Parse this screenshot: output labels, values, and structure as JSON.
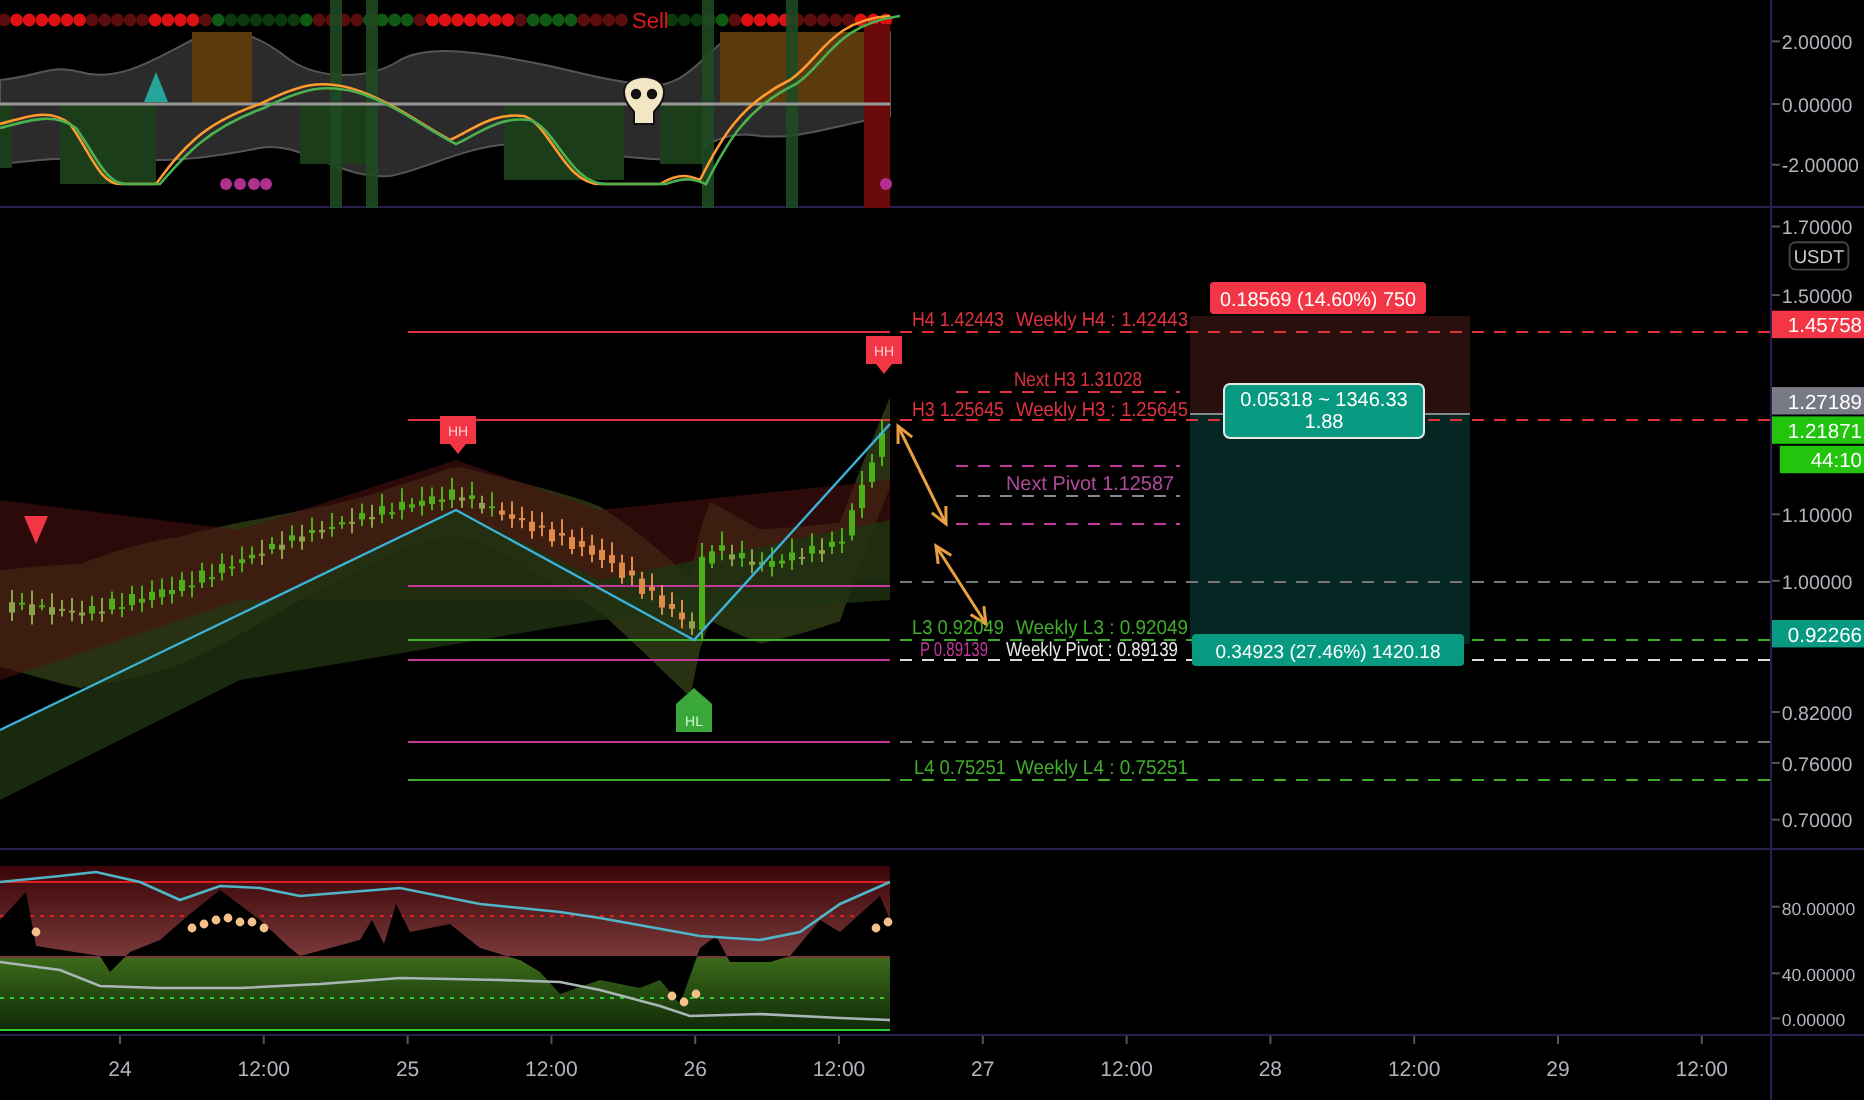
{
  "top_panel": {
    "signal_label": "Sell",
    "axis_labels": [
      "2.00000",
      "0.00000",
      "-2.00000"
    ]
  },
  "main_panel": {
    "currency": "USDT",
    "axis_labels": [
      "1.70000",
      "1.50000",
      "1.10000",
      "1.00000",
      "0.82000",
      "0.76000",
      "0.70000"
    ],
    "price_tags": [
      {
        "text": "1.45758",
        "color": "#f23645"
      },
      {
        "text": "1.27189",
        "color": "#787b86"
      },
      {
        "text": "1.21871",
        "color": "#22c40e"
      },
      {
        "text": "44:10",
        "color": "#22c40e"
      },
      {
        "text": "0.92266",
        "color": "#089981"
      }
    ],
    "pivots": [
      {
        "label": "H4 1.42443",
        "weekly_label": "Weekly H4 : 1.42443",
        "color": "#e0313f"
      },
      {
        "label": "H3 1.25645",
        "weekly_label": "Weekly H3 : 1.25645",
        "color": "#e0313f"
      },
      {
        "label": "L3 0.92049",
        "weekly_label": "Weekly L3 : 0.92049",
        "color": "#3fae2a"
      },
      {
        "label": "P 0.89139",
        "weekly_label": "Weekly Pivot : 0.89139",
        "color": "#c2399b"
      },
      {
        "label": "L4 0.75251",
        "weekly_label": "Weekly L4 : 0.75251",
        "color": "#3fae2a"
      }
    ],
    "next_levels": [
      "Next H3 1.31028",
      "Next Pivot 1.12587"
    ],
    "markers": [
      {
        "text": "HH",
        "kind": "high"
      },
      {
        "text": "HH",
        "kind": "high"
      },
      {
        "text": "HL",
        "kind": "low"
      }
    ],
    "position": {
      "target_label": "0.18569 (14.60%) 750",
      "info_lines": [
        "0.05318 ~ 1346.33",
        "1.88"
      ],
      "stop_label": "0.34923 (27.46%) 1420.18"
    }
  },
  "bottom_panel": {
    "axis_labels": [
      "80.00000",
      "40.00000",
      "0.00000"
    ]
  },
  "time_axis": {
    "labels": [
      "24",
      "12:00",
      "25",
      "12:00",
      "26",
      "12:00",
      "27",
      "12:00",
      "28",
      "12:00",
      "29",
      "12:00"
    ]
  }
}
